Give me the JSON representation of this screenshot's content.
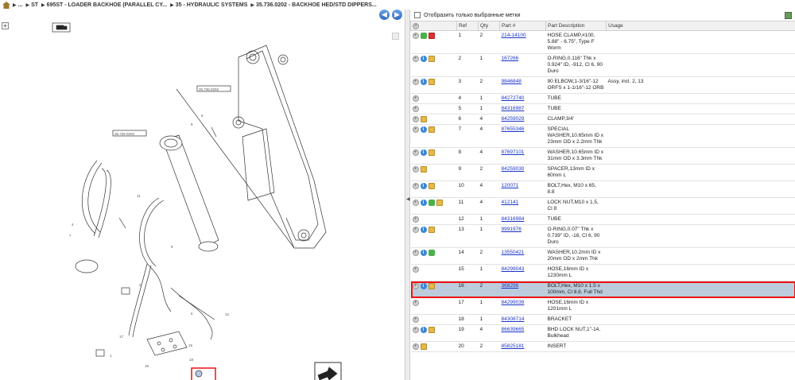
{
  "breadcrumb": {
    "items": [
      "...",
      "ST",
      "695ST - LOADER BACKHOE (PARALLEL CY...",
      "35 - HYDRAULIC SYSTEMS",
      "35.736.0202 - BACKHOE HED/STD DIPPERS..."
    ]
  },
  "nav": {
    "back": "◀",
    "forward": "▶",
    "expand": "+"
  },
  "filter": {
    "label": "Отобразить только выбранные метки"
  },
  "table": {
    "columns": [
      "",
      "Ref",
      "Qty",
      "Part #",
      "Part Description",
      "Usage"
    ],
    "rows": [
      {
        "ref": "1",
        "qty": "2",
        "part": "214-14100",
        "desc": "HOSE CLAMP,#100, 5.88\" - 6.75\", Type F Worm",
        "usage": "",
        "icons": [
          "plus",
          "green",
          "flag"
        ]
      },
      {
        "ref": "2",
        "qty": "1",
        "part": "167266",
        "desc": "O-RING,0.116\" Thk x 0.924\" ID, -912, Cl 6, 90 Duro",
        "usage": "",
        "icons": [
          "plus",
          "info",
          "note"
        ]
      },
      {
        "ref": "3",
        "qty": "2",
        "part": "9846848",
        "desc": "90 ELBOW,1-3/16\"-12 ORFS x 1-1/16\"-12 ORB",
        "usage": "Assy, incl. 2, 13",
        "icons": [
          "plus",
          "info",
          "note"
        ]
      },
      {
        "ref": "4",
        "qty": "1",
        "part": "84272740",
        "desc": "TUBE",
        "usage": "",
        "icons": [
          "plus"
        ]
      },
      {
        "ref": "5",
        "qty": "1",
        "part": "84316987",
        "desc": "TUBE",
        "usage": "",
        "icons": [
          "plus"
        ]
      },
      {
        "ref": "6",
        "qty": "4",
        "part": "84259029",
        "desc": "CLAMP,3/4'",
        "usage": "",
        "icons": [
          "plus",
          "note"
        ]
      },
      {
        "ref": "7",
        "qty": "4",
        "part": "87655346",
        "desc": "SPECIAL WASHER,10.65mm ID x 23mm OD x 2.2mm Thk",
        "usage": "",
        "icons": [
          "plus",
          "info",
          "note"
        ]
      },
      {
        "ref": "8",
        "qty": "4",
        "part": "87697101",
        "desc": "WASHER,10.65mm ID x 31mm OD x 3.3mm Thk",
        "usage": "",
        "icons": [
          "plus",
          "info",
          "note"
        ]
      },
      {
        "ref": "9",
        "qty": "2",
        "part": "84259030",
        "desc": "SPACER,13mm ID x 60mm L",
        "usage": "",
        "icons": [
          "plus",
          "note"
        ]
      },
      {
        "ref": "10",
        "qty": "4",
        "part": "120071",
        "desc": "BOLT,Hex, M10 x 65, 8.8",
        "usage": "",
        "icons": [
          "plus",
          "info",
          "note"
        ]
      },
      {
        "ref": "11",
        "qty": "4",
        "part": "412141",
        "desc": "LOCK NUT,M10 x 1.5, Cl 8",
        "usage": "",
        "icons": [
          "plus",
          "info",
          "green",
          "note"
        ]
      },
      {
        "ref": "12",
        "qty": "1",
        "part": "84316984",
        "desc": "TUBE",
        "usage": "",
        "icons": [
          "plus"
        ]
      },
      {
        "ref": "13",
        "qty": "1",
        "part": "9991976",
        "desc": "O-RING,0.07\" Thk x 0.739\" ID, -16, Cl 6, 90 Duro",
        "usage": "",
        "icons": [
          "plus",
          "info",
          "note"
        ]
      },
      {
        "ref": "14",
        "qty": "2",
        "part": "13550421",
        "desc": "WASHER,10.2mm ID x 20mm OD x 2mm Thk",
        "usage": "",
        "icons": [
          "plus",
          "info",
          "green"
        ]
      },
      {
        "ref": "15",
        "qty": "1",
        "part": "84299043",
        "desc": "HOSE,16mm ID x 1230mm L",
        "usage": "",
        "icons": [
          "plus"
        ]
      },
      {
        "ref": "16",
        "qty": "2",
        "part": "368296",
        "desc": "BOLT,Hex, M10 x 1.5 x 100mm, Cl 8.8, Full Thd",
        "usage": "",
        "icons": [
          "plus",
          "info",
          "note"
        ],
        "selected": true
      },
      {
        "ref": "17",
        "qty": "1",
        "part": "84299039",
        "desc": "HOSE,16mm ID x 1201mm L",
        "usage": "",
        "icons": [
          "plus"
        ]
      },
      {
        "ref": "18",
        "qty": "1",
        "part": "84308714",
        "desc": "BRACKET",
        "usage": "",
        "icons": [
          "plus"
        ]
      },
      {
        "ref": "19",
        "qty": "4",
        "part": "86639665",
        "desc": "BHD LOCK NUT,1\"-14, Bulkhead",
        "usage": "",
        "icons": [
          "plus",
          "info",
          "note"
        ]
      },
      {
        "ref": "20",
        "qty": "2",
        "part": "85825181",
        "desc": "INSERT",
        "usage": "",
        "icons": [
          "plus",
          "note"
        ]
      }
    ]
  },
  "diagram": {
    "labels": [
      "35.736.0202",
      "35.736.0202",
      "1",
      "2",
      "3",
      "4",
      "5",
      "6",
      "7",
      "8",
      "9",
      "10",
      "11",
      "12",
      "13",
      "14",
      "15",
      "16",
      "17",
      "18",
      "19",
      "20"
    ]
  }
}
